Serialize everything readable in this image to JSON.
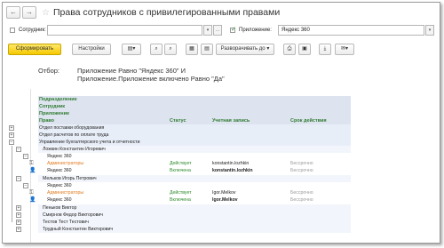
{
  "window": {
    "back": "←",
    "forward": "→",
    "star": "☆",
    "title": "Права сотрудников с привилегированными правами"
  },
  "filters": {
    "employee_label": "Сотрудник:",
    "employee_value": "",
    "app_label": "Приложение:",
    "app_value": "Яндекс 360"
  },
  "toolbar": {
    "generate": "Сформировать",
    "settings": "Настройки",
    "expand": "Разворачивать до"
  },
  "filter_info": {
    "label": "Отбор:",
    "line1": "Приложение Равно \"Яндекс 360\" И",
    "line2": "Приложение.Приложение включено Равно \"Да\""
  },
  "report": {
    "group_headers": [
      "Подразделение",
      "Сотрудник",
      "Приложение"
    ],
    "columns": [
      "Право",
      "Статус",
      "Учетная запись",
      "Срок действия"
    ],
    "departments": [
      "Отдел поставки оборудования",
      "Отдел расчетов по оплате труда",
      "Управление бухгалтерского учета и отчетности"
    ],
    "employee1": {
      "name": "Ложкин Константин Игоревич",
      "app": "Яндекс 360",
      "rights": [
        {
          "right": "Администраторы",
          "status": "Действует",
          "account": "konstantin.lozhkin",
          "term": "Бессрочно"
        },
        {
          "right": "Яндекс 360",
          "status": "Включена",
          "account": "konstantin.lozhkin",
          "term": "Бессрочно"
        }
      ]
    },
    "employee2": {
      "name": "Мельков Игорь Петрович",
      "app": "Яндекс 360",
      "rights": [
        {
          "right": "Администраторы",
          "status": "Действует",
          "account": "Igor.Melkov",
          "term": "Бессрочно"
        },
        {
          "right": "Яндекс 360",
          "status": "Включена",
          "account": "Igor.Melkov",
          "term": "Бессрочно"
        }
      ]
    },
    "other_employees": [
      "Пеньков Виктор",
      "Смирнов Федор Викторович",
      "Тестов Тест Тестович",
      "Трудный Константин Викторович"
    ]
  },
  "colors": {
    "accent": "#f5c900",
    "group_bg": "#dde4f0",
    "header_text": "#2f7a2f",
    "admin_text": "#e07a1f",
    "status_text": "#2a8a2a"
  }
}
